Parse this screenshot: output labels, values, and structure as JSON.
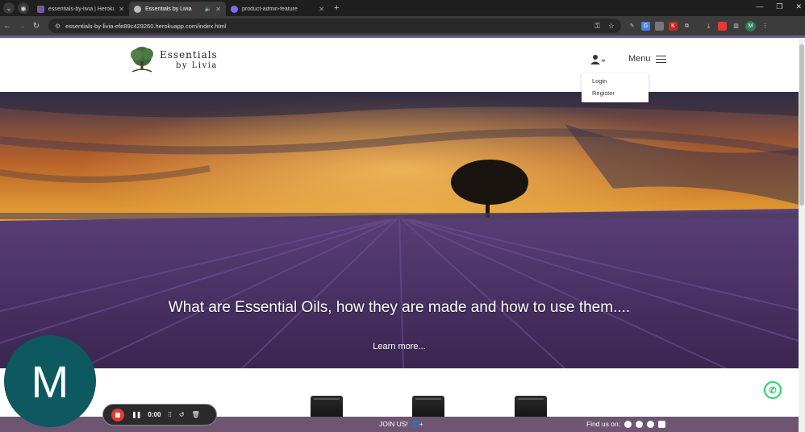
{
  "browser": {
    "tabs": [
      {
        "title": "essentials-by-livia | Heroku",
        "active": false,
        "favicon_color": "#79589f"
      },
      {
        "title": "Essentials by Livia",
        "active": true,
        "favicon_color": "#bdbdbd",
        "audio": true
      },
      {
        "title": "product-admin-feature",
        "active": false,
        "favicon_color": "#7c6cf5"
      }
    ],
    "url": "essentials-by-livia-efe89c429260.herokuapp.com/index.html",
    "profile_initial": "M"
  },
  "site": {
    "brand_line1": "Essentials",
    "brand_line2": "by Livia",
    "menu_label": "Menu",
    "account_dropdown": {
      "login": "Login",
      "register": "Register"
    },
    "hero": {
      "title": "What are Essential Oils, how they are made and how to use them....",
      "link": "Learn more..."
    },
    "footer": {
      "join": "JOIN US!",
      "find_us": "Find us on:",
      "socials": [
        "whatsapp-icon",
        "messenger-icon",
        "facebook-icon",
        "instagram-icon"
      ],
      "bg_color": "#6e5673"
    }
  },
  "recorder": {
    "avatar_letter": "M",
    "timer": "0:00"
  }
}
